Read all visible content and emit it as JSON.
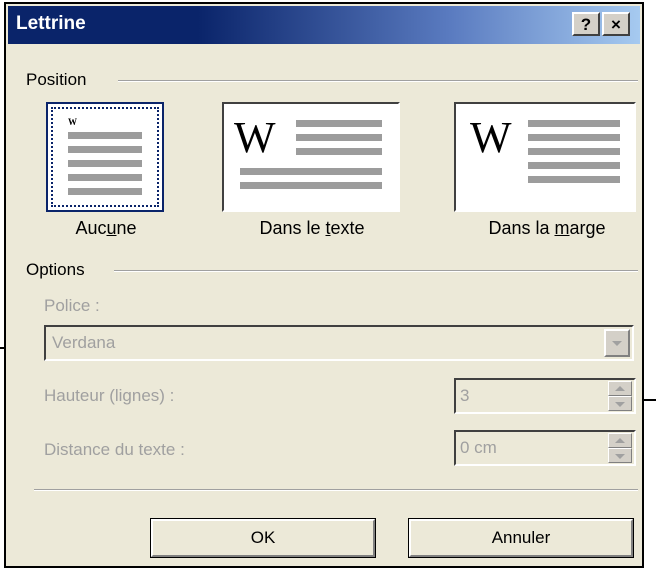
{
  "window": {
    "title": "Lettrine",
    "help_label": "?",
    "close_label": "×"
  },
  "position": {
    "group_label": "Position",
    "options": [
      {
        "label_pre": "Auc",
        "label_key": "u",
        "label_post": "ne",
        "selected": true
      },
      {
        "label_pre": "Dans le ",
        "label_key": "t",
        "label_post": "exte",
        "selected": false
      },
      {
        "label_pre": "Dans la ",
        "label_key": "m",
        "label_post": "arge",
        "selected": false
      }
    ],
    "letter": "W"
  },
  "options": {
    "group_label": "Options",
    "font_label": "Police :",
    "font_value": "Verdana",
    "height_label": "Hauteur (lignes) :",
    "height_value": "3",
    "distance_label": "Distance du texte :",
    "distance_value": "0 cm",
    "disabled": true
  },
  "buttons": {
    "ok": "OK",
    "cancel": "Annuler"
  },
  "colors": {
    "dialog_bg": "#ece9d8",
    "title_bar": "#0a246a",
    "disabled_text": "#a0a0a0"
  }
}
